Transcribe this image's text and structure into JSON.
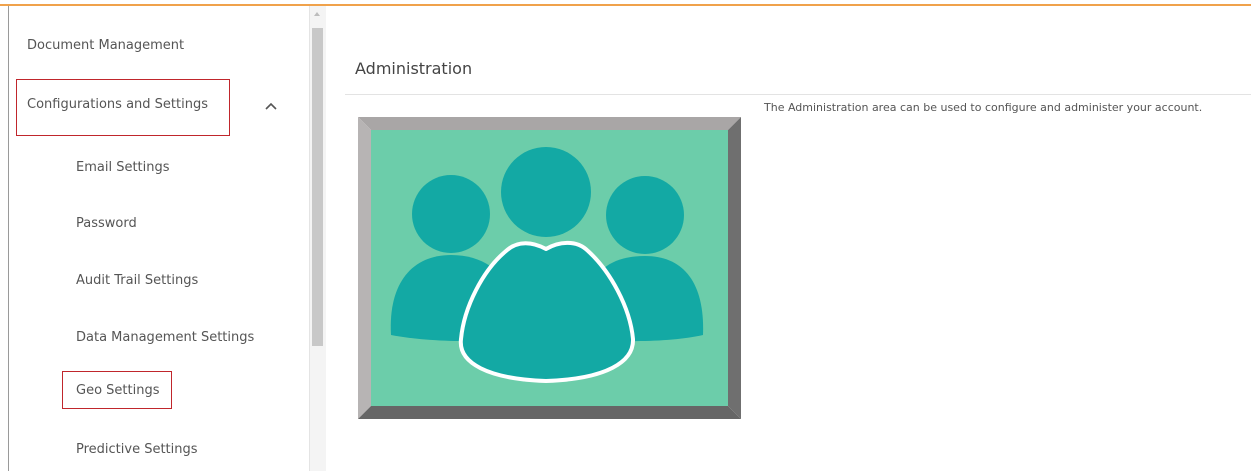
{
  "sidebar": {
    "items": [
      {
        "label": "Document Management"
      },
      {
        "label": "Configurations and Settings",
        "expanded": true
      },
      {
        "label": "Email Settings"
      },
      {
        "label": "Password"
      },
      {
        "label": "Audit Trail Settings"
      },
      {
        "label": "Data Management Settings"
      },
      {
        "label": "Geo Settings"
      },
      {
        "label": "Predictive Settings"
      }
    ]
  },
  "content": {
    "title": "Administration",
    "description": "The Administration area can be used to configure and administer your account.",
    "image_icon": "users-group-icon"
  },
  "colors": {
    "top_accent": "#f0a24b",
    "highlight_border": "#c0262c",
    "image_background": "#6ccdaa",
    "icon_fill": "#13a9a4",
    "frame_light": "#a9a6a6",
    "frame_dark": "#6f6f6f"
  }
}
